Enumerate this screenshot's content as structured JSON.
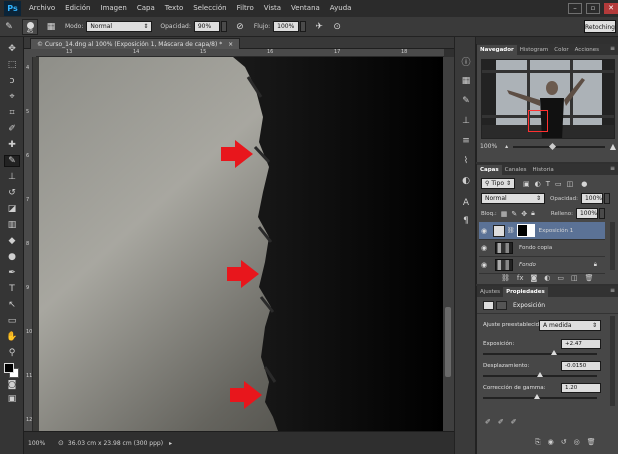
{
  "app": {
    "logo": "Ps"
  },
  "menu": [
    "Archivo",
    "Edición",
    "Imagen",
    "Capa",
    "Texto",
    "Selección",
    "Filtro",
    "Vista",
    "Ventana",
    "Ayuda"
  ],
  "window_controls": {
    "minimize": "–",
    "restore": "▫",
    "close": "✕"
  },
  "options_bar": {
    "brush_size": "45",
    "mode_label": "Modo:",
    "mode_value": "Normal",
    "opacity_label": "Opacidad:",
    "opacity_value": "90%",
    "flow_label": "Flujo:",
    "flow_value": "100%",
    "workspace": "Retoching"
  },
  "document": {
    "tab_title": "© Curso_14.dng al 100% (Exposición 1, Máscara de capa/8) *",
    "close": "×"
  },
  "ruler": {
    "top_ticks": [
      "13",
      "14",
      "15",
      "16",
      "17",
      "18"
    ],
    "left_ticks": [
      "4",
      "5",
      "6",
      "7",
      "8",
      "9",
      "10",
      "11",
      "12"
    ]
  },
  "status": {
    "zoom": "100%",
    "doc_size": "36.03 cm x 23.98 cm (300 ppp)"
  },
  "navigator": {
    "tabs": [
      "Navegador",
      "Histogram",
      "Color",
      "Acciones"
    ],
    "zoom": "100%"
  },
  "layers_panel": {
    "tabs": [
      "Capas",
      "Canales",
      "Historia"
    ],
    "filter_type": "Tipo",
    "blend_mode": "Normal",
    "opacity_label": "Opacidad:",
    "opacity_value": "100%",
    "lock_label": "Bloq.:",
    "fill_label": "Relleno:",
    "fill_value": "100%",
    "layers": [
      {
        "name": "Exposición 1",
        "selected": true
      },
      {
        "name": "Fondo copia",
        "selected": false
      },
      {
        "name": "Fondo",
        "selected": false,
        "italic": true
      }
    ]
  },
  "properties_panel": {
    "tabs": [
      "Ajustes",
      "Propiedades"
    ],
    "title": "Exposición",
    "preset_label": "Ajuste preestablecido:",
    "preset_value": "A medida",
    "exposure_label": "Exposición:",
    "exposure_value": "+2.47",
    "exposure_level": 0.62,
    "offset_label": "Desplazamiento:",
    "offset_value": "-0.0150",
    "offset_level": 0.5,
    "gamma_label": "Corrección de gamma:",
    "gamma_value": "1.20",
    "gamma_level": 0.47
  },
  "colors": {
    "arrow": "#e8161c",
    "selected_layer": "#5b7296",
    "accent": "#32b4ff"
  }
}
